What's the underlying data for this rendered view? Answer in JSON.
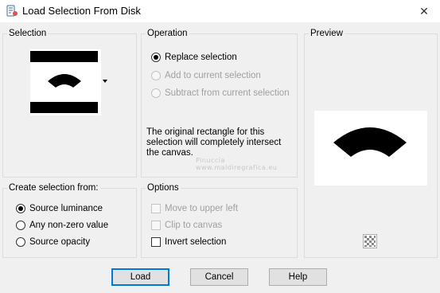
{
  "window": {
    "title": "Load Selection From Disk",
    "close_glyph": "✕"
  },
  "selection_group": {
    "label": "Selection"
  },
  "operation_group": {
    "label": "Operation",
    "options": [
      {
        "label": "Replace selection",
        "checked": true,
        "disabled": false
      },
      {
        "label": "Add to current selection",
        "checked": false,
        "disabled": true
      },
      {
        "label": "Subtract from current selection",
        "checked": false,
        "disabled": true
      }
    ],
    "description_lines": [
      "The original rectangle for this",
      "selection will completely intersect",
      "the canvas."
    ]
  },
  "preview_group": {
    "label": "Preview"
  },
  "create_from_group": {
    "label": "Create selection from:",
    "options": [
      {
        "label": "Source luminance",
        "checked": true
      },
      {
        "label": "Any non-zero value",
        "checked": false
      },
      {
        "label": "Source opacity",
        "checked": false
      }
    ]
  },
  "options_group": {
    "label": "Options",
    "items": [
      {
        "label": "Move to upper left",
        "checked": false,
        "disabled": true
      },
      {
        "label": "Clip to canvas",
        "checked": false,
        "disabled": true
      },
      {
        "label": "Invert selection",
        "checked": false,
        "disabled": false
      }
    ]
  },
  "buttons": {
    "load": "Load",
    "cancel": "Cancel",
    "help": "Help"
  },
  "watermark": {
    "line1": "Pinuccia",
    "line2": "www.maldiregrafica.eu"
  },
  "colors": {
    "accent": "#0078d7",
    "disabled_text": "#a0a0a0",
    "background": "#f0f0f0"
  }
}
